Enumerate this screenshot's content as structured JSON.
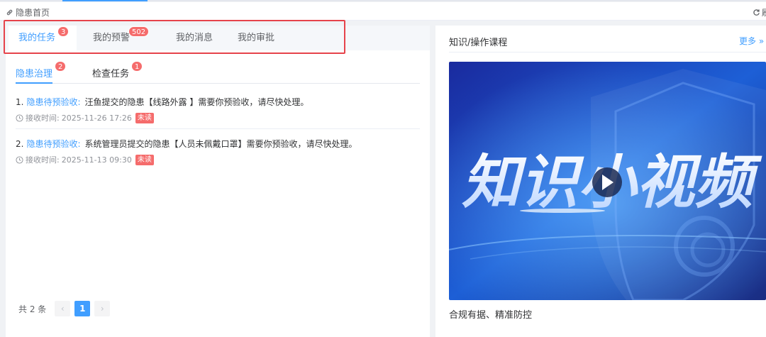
{
  "breadcrumb": {
    "text": "隐患首页",
    "icon": "link-icon"
  },
  "refresh": {
    "label": "刷",
    "icon": "refresh-icon"
  },
  "main_tabs": [
    {
      "label": "我的任务",
      "badge": "3",
      "active": true
    },
    {
      "label": "我的预警",
      "badge": "502",
      "active": false
    },
    {
      "label": "我的消息",
      "badge": "",
      "active": false
    },
    {
      "label": "我的审批",
      "badge": "",
      "active": false
    }
  ],
  "sub_tabs": [
    {
      "label": "隐患治理",
      "badge": "2",
      "active": true
    },
    {
      "label": "检查任务",
      "badge": "1",
      "active": false
    }
  ],
  "items": [
    {
      "index": "1.",
      "type": "隐患待预验收:",
      "message": "汪鱼提交的隐患【线路外露 】需要你预验收，请尽快处理。",
      "time_label": "接收时间:",
      "time": "2025-11-26 17:26",
      "status": "未读"
    },
    {
      "index": "2.",
      "type": "隐患待预验收:",
      "message": "系统管理员提交的隐患【人员未佩戴口罩】需要你预验收，请尽快处理。",
      "time_label": "接收时间:",
      "time": "2025-11-13 09:30",
      "status": "未读"
    }
  ],
  "pagination": {
    "total": "共 2 条",
    "current": "1",
    "prev": "‹",
    "next": "›"
  },
  "knowledge": {
    "title": "知识/操作课程",
    "more": "更多",
    "video_title": "知识小视频",
    "caption": "合规有据、精准防控"
  },
  "colors": {
    "accent": "#409eff",
    "badge": "#f56c6c",
    "highlight": "#e6434b"
  }
}
